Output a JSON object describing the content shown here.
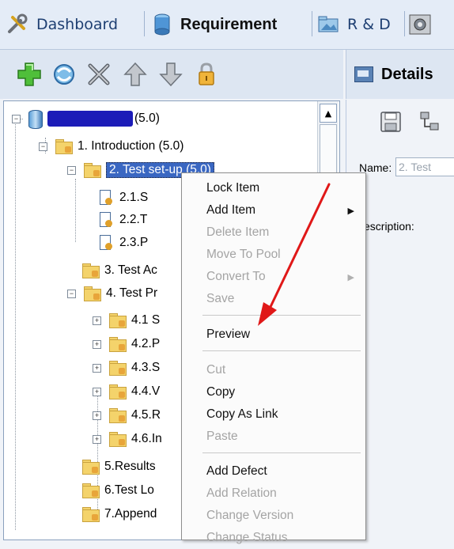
{
  "tabs": [
    {
      "label": "Dashboard",
      "active": false,
      "icon": "tools-icon"
    },
    {
      "label": "Requirement",
      "active": true,
      "icon": "database-icon"
    },
    {
      "label": "R & D",
      "active": false,
      "icon": "folder-icon"
    }
  ],
  "toolbar": {
    "buttons": [
      "add-icon",
      "refresh-icon",
      "delete-icon",
      "move-up-icon",
      "move-down-icon",
      "lock-icon"
    ]
  },
  "details": {
    "title": "Details",
    "name_label": "Name:",
    "name_value": "2. Test",
    "description_label": "escription:"
  },
  "tree": {
    "root": "(5.0)",
    "nodes": [
      {
        "label": "1. Introduction (5.0)"
      },
      {
        "label": "2. Test set-up (5.0)",
        "selected": true
      },
      {
        "label": "2.1.S"
      },
      {
        "label": "2.2.T"
      },
      {
        "label": "2.3.P"
      },
      {
        "label": "3. Test Ac"
      },
      {
        "label": "4. Test Pr"
      },
      {
        "label": "4.1 S"
      },
      {
        "label": "4.2.P"
      },
      {
        "label": "4.3.S"
      },
      {
        "label": "4.4.V"
      },
      {
        "label": "4.5.R"
      },
      {
        "label": "4.6.In"
      },
      {
        "label": "5.Results"
      },
      {
        "label": "6.Test Lo"
      },
      {
        "label": "7.Append"
      }
    ]
  },
  "context_menu": {
    "items": [
      {
        "label": "Lock Item",
        "disabled": false
      },
      {
        "label": "Add Item",
        "disabled": false,
        "submenu": true
      },
      {
        "label": "Delete Item",
        "disabled": true
      },
      {
        "label": "Move To Pool",
        "disabled": true
      },
      {
        "label": "Convert To",
        "disabled": true,
        "submenu": true
      },
      {
        "label": "Save",
        "disabled": true
      },
      {
        "label": "Preview",
        "disabled": false
      },
      {
        "label": "Cut",
        "disabled": true
      },
      {
        "label": "Copy",
        "disabled": false
      },
      {
        "label": "Copy As Link",
        "disabled": false
      },
      {
        "label": "Paste",
        "disabled": true
      },
      {
        "label": "Add Defect",
        "disabled": false
      },
      {
        "label": "Add Relation",
        "disabled": true
      },
      {
        "label": "Change Version",
        "disabled": true
      },
      {
        "label": "Change Status",
        "disabled": true
      }
    ]
  },
  "colors": {
    "selection": "#3a67c2",
    "annotation_arrow": "#e01818"
  }
}
